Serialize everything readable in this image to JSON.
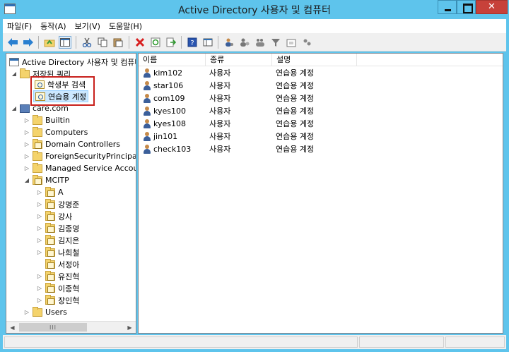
{
  "window": {
    "title": "Active Directory 사용자 및 컴퓨터",
    "close_glyph": "✕"
  },
  "menu": [
    "파일(F)",
    "동작(A)",
    "보기(V)",
    "도움말(H)"
  ],
  "toolbar_icons": [
    "back-arrow-icon",
    "forward-arrow-icon",
    "up-folder-icon",
    "show-tree-icon",
    "cut-icon",
    "copy-icon",
    "paste-icon",
    "delete-icon",
    "refresh-icon",
    "export-list-icon",
    "help-icon",
    "console-icon",
    "users-icon",
    "add-user-icon",
    "add-group-icon",
    "filter-icon",
    "add-ou-icon",
    "delegate-icon"
  ],
  "tree": {
    "root": "Active Directory 사용자 및 컴퓨터",
    "saved_queries": "저장된 쿼리",
    "queries": [
      "학생부 검색",
      "연습용 계정"
    ],
    "domain": "care.com",
    "containers": [
      "Builtin",
      "Computers",
      "Domain Controllers",
      "ForeignSecurityPrincipal",
      "Managed Service Accou",
      "MCITP"
    ],
    "mcitp_children": [
      "A",
      "강명준",
      "강사",
      "김종영",
      "김지은",
      "나희철",
      "서정아",
      "유진혁",
      "이종혁",
      "장인혁"
    ],
    "users": "Users",
    "scroll_thumb": "III"
  },
  "list": {
    "columns": [
      "이름",
      "종류",
      "설명"
    ],
    "rows": [
      {
        "name": "kim102",
        "type": "사용자",
        "desc": "연습용 계정"
      },
      {
        "name": "star106",
        "type": "사용자",
        "desc": "연습용 계정"
      },
      {
        "name": "com109",
        "type": "사용자",
        "desc": "연습용 계정"
      },
      {
        "name": "kyes100",
        "type": "사용자",
        "desc": "연습용 계정"
      },
      {
        "name": "kyes108",
        "type": "사용자",
        "desc": "연습용 계정"
      },
      {
        "name": "jin101",
        "type": "사용자",
        "desc": "연습용 계정"
      },
      {
        "name": "check103",
        "type": "사용자",
        "desc": "연습용 계정"
      }
    ]
  },
  "colors": {
    "title_bar": "#5ec4ec",
    "close_button": "#c7413a",
    "highlight_box": "#c8201c",
    "selection": "#cce8ff"
  }
}
